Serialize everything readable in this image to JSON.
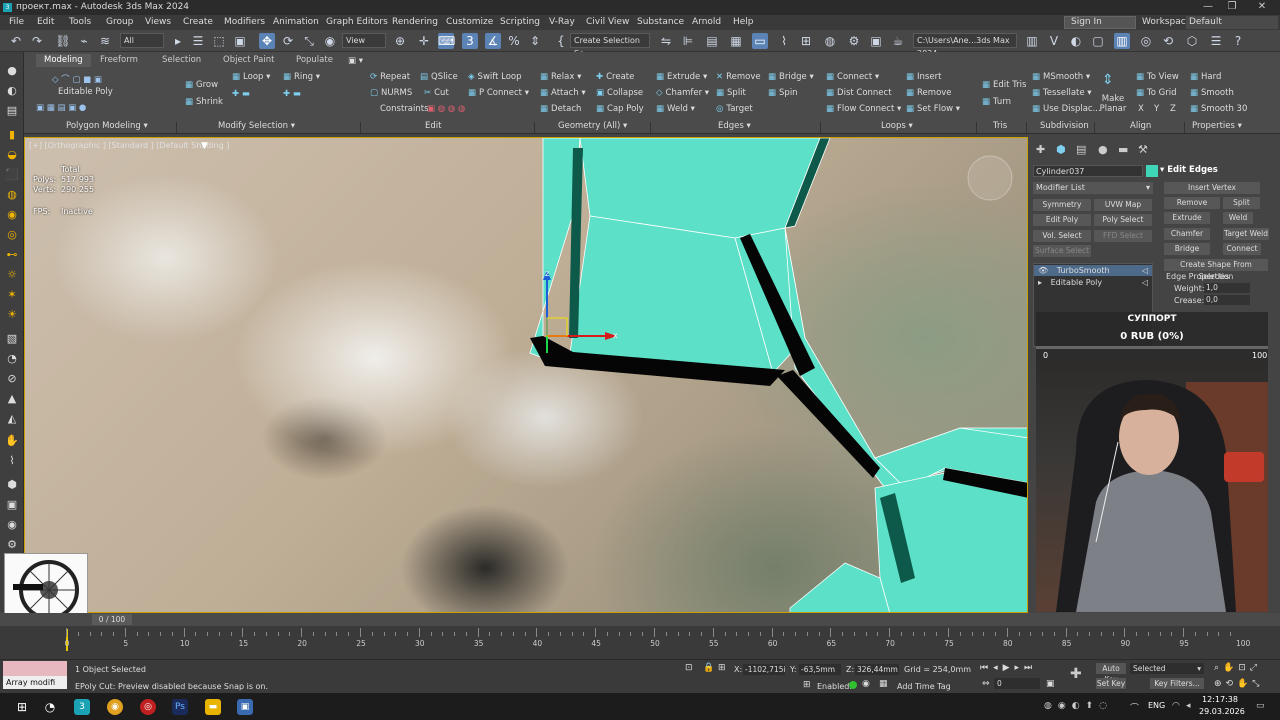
{
  "window": {
    "title": "проект.max - Autodesk 3ds Max 2024",
    "min": "—",
    "max": "❐",
    "close": "✕"
  },
  "menu": [
    "File",
    "Edit",
    "Tools",
    "Group",
    "Views",
    "Create",
    "Modifiers",
    "Animation",
    "Graph Editors",
    "Rendering",
    "Customize",
    "Scripting",
    "V-Ray",
    "Civil View",
    "Substance",
    "Arnold",
    "Help"
  ],
  "menu_right": {
    "signin": "Sign In",
    "workspaces_label": "Workspaces:",
    "workspace": "Default"
  },
  "toolbar": {
    "filter": "All",
    "view": "View",
    "selection_set": "Create Selection Se",
    "path": "C:\\Users\\Ane...3ds Max 2024"
  },
  "ribbon": {
    "tabs": [
      "Modeling",
      "Freeform",
      "Selection",
      "Object Paint",
      "Populate"
    ],
    "editable_poly": "Editable Poly",
    "items": {
      "grow": "Grow",
      "shrink": "Shrink",
      "loop": "Loop",
      "ring": "Ring",
      "repeat": "Repeat",
      "qslice": "QSlice",
      "swift_loop": "Swift Loop",
      "nurms": "NURMS",
      "cut": "Cut",
      "p_connect": "P Connect",
      "constraints": "Constraints:",
      "relax": "Relax",
      "create": "Create",
      "attach": "Attach",
      "collapse": "Collapse",
      "detach": "Detach",
      "cap_poly": "Cap Poly",
      "extrude": "Extrude",
      "remove": "Remove",
      "bridge": "Bridge",
      "chamfer": "Chamfer",
      "split": "Split",
      "spin": "Spin",
      "weld": "Weld",
      "target": "Target",
      "connect": "Connect",
      "dist_connect": "Dist Connect",
      "flow_connect": "Flow Connect",
      "insert": "Insert",
      "remove2": "Remove",
      "set_flow": "Set Flow",
      "edit_tris": "Edit Tris",
      "turn": "Turn",
      "msmooth": "MSmooth",
      "tessellate": "Tessellate",
      "use_displac": "Use Displac...",
      "make_planar": "Make Planar",
      "to_view": "To View",
      "to_grid": "To Grid",
      "x": "X",
      "y": "Y",
      "z": "Z",
      "hard": "Hard",
      "smooth": "Smooth",
      "smooth30": "Smooth 30"
    },
    "groups": [
      "Polygon Modeling ▾",
      "Modify Selection ▾",
      "Edit",
      "Geometry (All) ▾",
      "Edges ▾",
      "Loops ▾",
      "Tris",
      "Subdivision",
      "Align",
      "Properties ▾"
    ]
  },
  "viewport": {
    "label": "[+] [Orthographic ] [Standard ] [Default Shading ]",
    "stats": {
      "total": "Total",
      "polys_label": "Polys:",
      "polys": "517 993",
      "verts_label": "Verts:",
      "verts": "290 255",
      "fps_label": "FPS:",
      "fps": "Inactive"
    },
    "gizmo": {
      "z": "z",
      "x": "x"
    }
  },
  "command_panel": {
    "object_name": "Cylinder037",
    "modifier_list": "Modifier List",
    "buttons": [
      "Symmetry",
      "UVW Map",
      "Edit Poly",
      "Poly Select",
      "Vol. Select",
      "FFD Select",
      "Surface Select"
    ],
    "stack": [
      "TurboSmooth",
      "Editable Poly"
    ],
    "rollout": "Edit Edges",
    "edit_edges": {
      "insert_vertex": "Insert Vertex",
      "remove": "Remove",
      "split": "Split",
      "extrude": "Extrude",
      "weld": "Weld",
      "chamfer": "Chamfer",
      "target_weld": "Target Weld",
      "bridge": "Bridge",
      "connect": "Connect",
      "create_shape": "Create Shape From Selection",
      "edge_props": "Edge Properties",
      "weight_label": "Weight:",
      "weight": "1,0",
      "crease_label": "Crease:",
      "crease": "0,0"
    }
  },
  "donate": {
    "title": "СУППОРТ",
    "amount": "0 RUB (0%)",
    "min": "0",
    "max": "100"
  },
  "timeline": {
    "counter": "0 / 100",
    "ticks": [
      "0",
      "5",
      "10",
      "15",
      "20",
      "25",
      "30",
      "35",
      "40",
      "45",
      "50",
      "55",
      "60",
      "65",
      "70",
      "75",
      "80",
      "85",
      "90",
      "95",
      "100"
    ]
  },
  "status": {
    "selected": "1 Object Selected",
    "prompt": "EPoly Cut: Preview disabled because Snap is on.",
    "maxscript": "Array modifi",
    "x_label": "X:",
    "x": "-1102,715i",
    "y_label": "Y:",
    "y": "-63,5mm",
    "z_label": "Z:",
    "z": "326,44mm",
    "grid": "Grid = 254,0mm",
    "enabled": "Enabled:",
    "add_time_tag": "Add Time Tag",
    "auto_key": "Auto Key",
    "selected_dd": "Selected",
    "set_key": "Set Key",
    "key_filters": "Key Filters...",
    "frame": "0"
  },
  "taskbar": {
    "lang": "ENG",
    "time": "12:17:38",
    "date": "29.03.2026"
  }
}
